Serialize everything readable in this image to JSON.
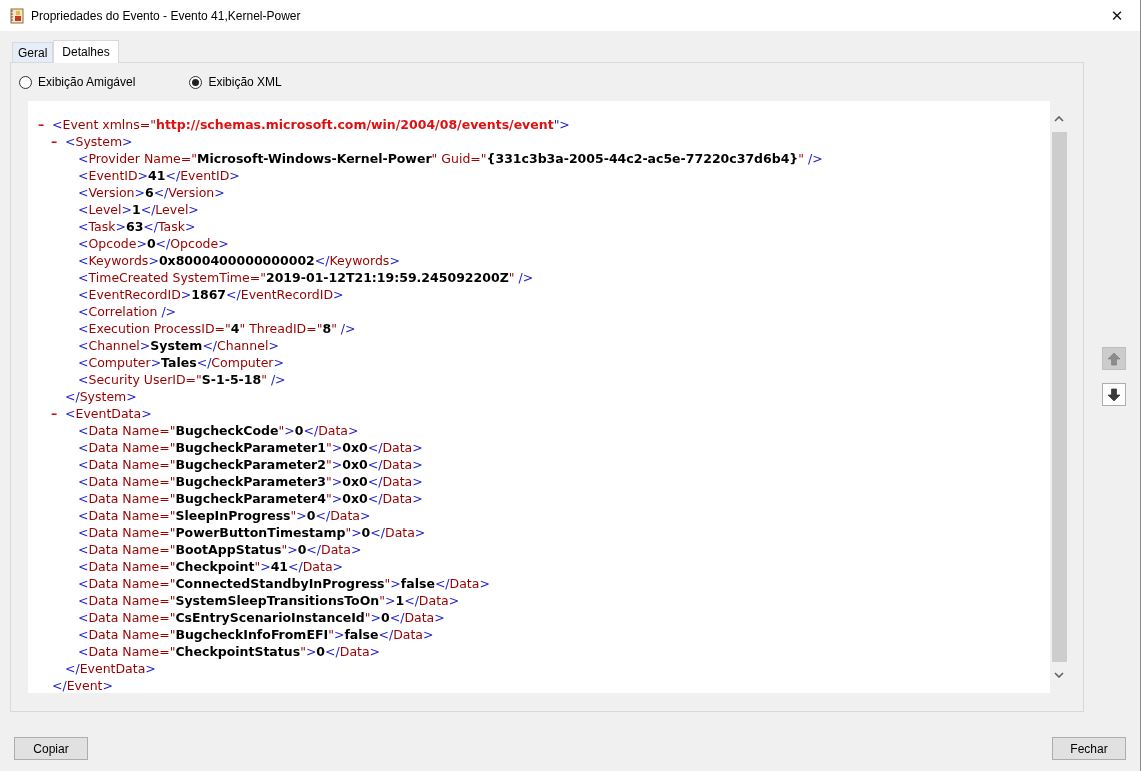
{
  "window": {
    "title": "Propriedades do Evento - Evento 41,Kernel-Power",
    "close": "✕"
  },
  "tabs": [
    {
      "label": "Geral",
      "selected": false
    },
    {
      "label": "Detalhes",
      "selected": true
    }
  ],
  "view_options": [
    {
      "label": "Exibição Amigável",
      "selected": false
    },
    {
      "label": "Exibição XML",
      "selected": true
    }
  ],
  "xml": {
    "toggle": "–",
    "expanded": true,
    "open": [
      {
        "kind": "markup",
        "text": "<"
      },
      {
        "kind": "tag",
        "text": "Event"
      },
      {
        "kind": "attr",
        "text": " xmlns=\""
      },
      {
        "kind": "ns",
        "text": "http://schemas.microsoft.com/win/2004/08/events/event"
      },
      {
        "kind": "markup",
        "text": "\">"
      }
    ],
    "close": [
      {
        "kind": "markup",
        "text": "</"
      },
      {
        "kind": "tag",
        "text": "Event"
      },
      {
        "kind": "markup",
        "text": ">"
      }
    ],
    "children": [
      {
        "toggle": "–",
        "expanded": true,
        "open": [
          {
            "kind": "markup",
            "text": "<"
          },
          {
            "kind": "tag",
            "text": "System"
          },
          {
            "kind": "markup",
            "text": ">"
          }
        ],
        "close": [
          {
            "kind": "markup",
            "text": "</"
          },
          {
            "kind": "tag",
            "text": "System"
          },
          {
            "kind": "markup",
            "text": ">"
          }
        ],
        "children": [
          {
            "open": [
              {
                "kind": "markup",
                "text": "<"
              },
              {
                "kind": "tag",
                "text": "Provider"
              },
              {
                "kind": "attr",
                "text": " Name=\""
              },
              {
                "kind": "value",
                "text": "Microsoft-Windows-Kernel-Power"
              },
              {
                "kind": "attr",
                "text": "\" Guid=\""
              },
              {
                "kind": "value",
                "text": "{331c3b3a-2005-44c2-ac5e-77220c37d6b4}"
              },
              {
                "kind": "attr",
                "text": "\""
              },
              {
                "kind": "markup",
                "text": " />"
              }
            ]
          },
          {
            "open": [
              {
                "kind": "markup",
                "text": "<"
              },
              {
                "kind": "tag",
                "text": "EventID"
              },
              {
                "kind": "markup",
                "text": ">"
              },
              {
                "kind": "text",
                "text": "41"
              },
              {
                "kind": "markup",
                "text": "</"
              },
              {
                "kind": "tag",
                "text": "EventID"
              },
              {
                "kind": "markup",
                "text": ">"
              }
            ]
          },
          {
            "open": [
              {
                "kind": "markup",
                "text": "<"
              },
              {
                "kind": "tag",
                "text": "Version"
              },
              {
                "kind": "markup",
                "text": ">"
              },
              {
                "kind": "text",
                "text": "6"
              },
              {
                "kind": "markup",
                "text": "</"
              },
              {
                "kind": "tag",
                "text": "Version"
              },
              {
                "kind": "markup",
                "text": ">"
              }
            ]
          },
          {
            "open": [
              {
                "kind": "markup",
                "text": "<"
              },
              {
                "kind": "tag",
                "text": "Level"
              },
              {
                "kind": "markup",
                "text": ">"
              },
              {
                "kind": "text",
                "text": "1"
              },
              {
                "kind": "markup",
                "text": "</"
              },
              {
                "kind": "tag",
                "text": "Level"
              },
              {
                "kind": "markup",
                "text": ">"
              }
            ]
          },
          {
            "open": [
              {
                "kind": "markup",
                "text": "<"
              },
              {
                "kind": "tag",
                "text": "Task"
              },
              {
                "kind": "markup",
                "text": ">"
              },
              {
                "kind": "text",
                "text": "63"
              },
              {
                "kind": "markup",
                "text": "</"
              },
              {
                "kind": "tag",
                "text": "Task"
              },
              {
                "kind": "markup",
                "text": ">"
              }
            ]
          },
          {
            "open": [
              {
                "kind": "markup",
                "text": "<"
              },
              {
                "kind": "tag",
                "text": "Opcode"
              },
              {
                "kind": "markup",
                "text": ">"
              },
              {
                "kind": "text",
                "text": "0"
              },
              {
                "kind": "markup",
                "text": "</"
              },
              {
                "kind": "tag",
                "text": "Opcode"
              },
              {
                "kind": "markup",
                "text": ">"
              }
            ]
          },
          {
            "open": [
              {
                "kind": "markup",
                "text": "<"
              },
              {
                "kind": "tag",
                "text": "Keywords"
              },
              {
                "kind": "markup",
                "text": ">"
              },
              {
                "kind": "text",
                "text": "0x8000400000000002"
              },
              {
                "kind": "markup",
                "text": "</"
              },
              {
                "kind": "tag",
                "text": "Keywords"
              },
              {
                "kind": "markup",
                "text": ">"
              }
            ]
          },
          {
            "open": [
              {
                "kind": "markup",
                "text": "<"
              },
              {
                "kind": "tag",
                "text": "TimeCreated"
              },
              {
                "kind": "attr",
                "text": " SystemTime=\""
              },
              {
                "kind": "value",
                "text": "2019-01-12T21:19:59.245092200Z"
              },
              {
                "kind": "attr",
                "text": "\""
              },
              {
                "kind": "markup",
                "text": " />"
              }
            ]
          },
          {
            "open": [
              {
                "kind": "markup",
                "text": "<"
              },
              {
                "kind": "tag",
                "text": "EventRecordID"
              },
              {
                "kind": "markup",
                "text": ">"
              },
              {
                "kind": "text",
                "text": "1867"
              },
              {
                "kind": "markup",
                "text": "</"
              },
              {
                "kind": "tag",
                "text": "EventRecordID"
              },
              {
                "kind": "markup",
                "text": ">"
              }
            ]
          },
          {
            "open": [
              {
                "kind": "markup",
                "text": "<"
              },
              {
                "kind": "tag",
                "text": "Correlation"
              },
              {
                "kind": "markup",
                "text": " />"
              }
            ]
          },
          {
            "open": [
              {
                "kind": "markup",
                "text": "<"
              },
              {
                "kind": "tag",
                "text": "Execution"
              },
              {
                "kind": "attr",
                "text": " ProcessID=\""
              },
              {
                "kind": "value",
                "text": "4"
              },
              {
                "kind": "attr",
                "text": "\" ThreadID=\""
              },
              {
                "kind": "value",
                "text": "8"
              },
              {
                "kind": "attr",
                "text": "\""
              },
              {
                "kind": "markup",
                "text": " />"
              }
            ]
          },
          {
            "open": [
              {
                "kind": "markup",
                "text": "<"
              },
              {
                "kind": "tag",
                "text": "Channel"
              },
              {
                "kind": "markup",
                "text": ">"
              },
              {
                "kind": "text",
                "text": "System"
              },
              {
                "kind": "markup",
                "text": "</"
              },
              {
                "kind": "tag",
                "text": "Channel"
              },
              {
                "kind": "markup",
                "text": ">"
              }
            ]
          },
          {
            "open": [
              {
                "kind": "markup",
                "text": "<"
              },
              {
                "kind": "tag",
                "text": "Computer"
              },
              {
                "kind": "markup",
                "text": ">"
              },
              {
                "kind": "text",
                "text": "Tales"
              },
              {
                "kind": "markup",
                "text": "</"
              },
              {
                "kind": "tag",
                "text": "Computer"
              },
              {
                "kind": "markup",
                "text": ">"
              }
            ]
          },
          {
            "open": [
              {
                "kind": "markup",
                "text": "<"
              },
              {
                "kind": "tag",
                "text": "Security"
              },
              {
                "kind": "attr",
                "text": " UserID=\""
              },
              {
                "kind": "value",
                "text": "S-1-5-18"
              },
              {
                "kind": "attr",
                "text": "\""
              },
              {
                "kind": "markup",
                "text": " />"
              }
            ]
          }
        ]
      },
      {
        "toggle": "–",
        "expanded": true,
        "open": [
          {
            "kind": "markup",
            "text": "<"
          },
          {
            "kind": "tag",
            "text": "EventData"
          },
          {
            "kind": "markup",
            "text": ">"
          }
        ],
        "close": [
          {
            "kind": "markup",
            "text": "</"
          },
          {
            "kind": "tag",
            "text": "EventData"
          },
          {
            "kind": "markup",
            "text": ">"
          }
        ],
        "children": [
          {
            "open": [
              {
                "kind": "markup",
                "text": "<"
              },
              {
                "kind": "tag",
                "text": "Data"
              },
              {
                "kind": "attr",
                "text": " Name=\""
              },
              {
                "kind": "value",
                "text": "BugcheckCode"
              },
              {
                "kind": "attr",
                "text": "\""
              },
              {
                "kind": "markup",
                "text": ">"
              },
              {
                "kind": "text",
                "text": "0"
              },
              {
                "kind": "markup",
                "text": "</"
              },
              {
                "kind": "tag",
                "text": "Data"
              },
              {
                "kind": "markup",
                "text": ">"
              }
            ]
          },
          {
            "open": [
              {
                "kind": "markup",
                "text": "<"
              },
              {
                "kind": "tag",
                "text": "Data"
              },
              {
                "kind": "attr",
                "text": " Name=\""
              },
              {
                "kind": "value",
                "text": "BugcheckParameter1"
              },
              {
                "kind": "attr",
                "text": "\""
              },
              {
                "kind": "markup",
                "text": ">"
              },
              {
                "kind": "text",
                "text": "0x0"
              },
              {
                "kind": "markup",
                "text": "</"
              },
              {
                "kind": "tag",
                "text": "Data"
              },
              {
                "kind": "markup",
                "text": ">"
              }
            ]
          },
          {
            "open": [
              {
                "kind": "markup",
                "text": "<"
              },
              {
                "kind": "tag",
                "text": "Data"
              },
              {
                "kind": "attr",
                "text": " Name=\""
              },
              {
                "kind": "value",
                "text": "BugcheckParameter2"
              },
              {
                "kind": "attr",
                "text": "\""
              },
              {
                "kind": "markup",
                "text": ">"
              },
              {
                "kind": "text",
                "text": "0x0"
              },
              {
                "kind": "markup",
                "text": "</"
              },
              {
                "kind": "tag",
                "text": "Data"
              },
              {
                "kind": "markup",
                "text": ">"
              }
            ]
          },
          {
            "open": [
              {
                "kind": "markup",
                "text": "<"
              },
              {
                "kind": "tag",
                "text": "Data"
              },
              {
                "kind": "attr",
                "text": " Name=\""
              },
              {
                "kind": "value",
                "text": "BugcheckParameter3"
              },
              {
                "kind": "attr",
                "text": "\""
              },
              {
                "kind": "markup",
                "text": ">"
              },
              {
                "kind": "text",
                "text": "0x0"
              },
              {
                "kind": "markup",
                "text": "</"
              },
              {
                "kind": "tag",
                "text": "Data"
              },
              {
                "kind": "markup",
                "text": ">"
              }
            ]
          },
          {
            "open": [
              {
                "kind": "markup",
                "text": "<"
              },
              {
                "kind": "tag",
                "text": "Data"
              },
              {
                "kind": "attr",
                "text": " Name=\""
              },
              {
                "kind": "value",
                "text": "BugcheckParameter4"
              },
              {
                "kind": "attr",
                "text": "\""
              },
              {
                "kind": "markup",
                "text": ">"
              },
              {
                "kind": "text",
                "text": "0x0"
              },
              {
                "kind": "markup",
                "text": "</"
              },
              {
                "kind": "tag",
                "text": "Data"
              },
              {
                "kind": "markup",
                "text": ">"
              }
            ]
          },
          {
            "open": [
              {
                "kind": "markup",
                "text": "<"
              },
              {
                "kind": "tag",
                "text": "Data"
              },
              {
                "kind": "attr",
                "text": " Name=\""
              },
              {
                "kind": "value",
                "text": "SleepInProgress"
              },
              {
                "kind": "attr",
                "text": "\""
              },
              {
                "kind": "markup",
                "text": ">"
              },
              {
                "kind": "text",
                "text": "0"
              },
              {
                "kind": "markup",
                "text": "</"
              },
              {
                "kind": "tag",
                "text": "Data"
              },
              {
                "kind": "markup",
                "text": ">"
              }
            ]
          },
          {
            "open": [
              {
                "kind": "markup",
                "text": "<"
              },
              {
                "kind": "tag",
                "text": "Data"
              },
              {
                "kind": "attr",
                "text": " Name=\""
              },
              {
                "kind": "value",
                "text": "PowerButtonTimestamp"
              },
              {
                "kind": "attr",
                "text": "\""
              },
              {
                "kind": "markup",
                "text": ">"
              },
              {
                "kind": "text",
                "text": "0"
              },
              {
                "kind": "markup",
                "text": "</"
              },
              {
                "kind": "tag",
                "text": "Data"
              },
              {
                "kind": "markup",
                "text": ">"
              }
            ]
          },
          {
            "open": [
              {
                "kind": "markup",
                "text": "<"
              },
              {
                "kind": "tag",
                "text": "Data"
              },
              {
                "kind": "attr",
                "text": " Name=\""
              },
              {
                "kind": "value",
                "text": "BootAppStatus"
              },
              {
                "kind": "attr",
                "text": "\""
              },
              {
                "kind": "markup",
                "text": ">"
              },
              {
                "kind": "text",
                "text": "0"
              },
              {
                "kind": "markup",
                "text": "</"
              },
              {
                "kind": "tag",
                "text": "Data"
              },
              {
                "kind": "markup",
                "text": ">"
              }
            ]
          },
          {
            "open": [
              {
                "kind": "markup",
                "text": "<"
              },
              {
                "kind": "tag",
                "text": "Data"
              },
              {
                "kind": "attr",
                "text": " Name=\""
              },
              {
                "kind": "value",
                "text": "Checkpoint"
              },
              {
                "kind": "attr",
                "text": "\""
              },
              {
                "kind": "markup",
                "text": ">"
              },
              {
                "kind": "text",
                "text": "41"
              },
              {
                "kind": "markup",
                "text": "</"
              },
              {
                "kind": "tag",
                "text": "Data"
              },
              {
                "kind": "markup",
                "text": ">"
              }
            ]
          },
          {
            "open": [
              {
                "kind": "markup",
                "text": "<"
              },
              {
                "kind": "tag",
                "text": "Data"
              },
              {
                "kind": "attr",
                "text": " Name=\""
              },
              {
                "kind": "value",
                "text": "ConnectedStandbyInProgress"
              },
              {
                "kind": "attr",
                "text": "\""
              },
              {
                "kind": "markup",
                "text": ">"
              },
              {
                "kind": "text",
                "text": "false"
              },
              {
                "kind": "markup",
                "text": "</"
              },
              {
                "kind": "tag",
                "text": "Data"
              },
              {
                "kind": "markup",
                "text": ">"
              }
            ]
          },
          {
            "open": [
              {
                "kind": "markup",
                "text": "<"
              },
              {
                "kind": "tag",
                "text": "Data"
              },
              {
                "kind": "attr",
                "text": " Name=\""
              },
              {
                "kind": "value",
                "text": "SystemSleepTransitionsToOn"
              },
              {
                "kind": "attr",
                "text": "\""
              },
              {
                "kind": "markup",
                "text": ">"
              },
              {
                "kind": "text",
                "text": "1"
              },
              {
                "kind": "markup",
                "text": "</"
              },
              {
                "kind": "tag",
                "text": "Data"
              },
              {
                "kind": "markup",
                "text": ">"
              }
            ]
          },
          {
            "open": [
              {
                "kind": "markup",
                "text": "<"
              },
              {
                "kind": "tag",
                "text": "Data"
              },
              {
                "kind": "attr",
                "text": " Name=\""
              },
              {
                "kind": "value",
                "text": "CsEntryScenarioInstanceId"
              },
              {
                "kind": "attr",
                "text": "\""
              },
              {
                "kind": "markup",
                "text": ">"
              },
              {
                "kind": "text",
                "text": "0"
              },
              {
                "kind": "markup",
                "text": "</"
              },
              {
                "kind": "tag",
                "text": "Data"
              },
              {
                "kind": "markup",
                "text": ">"
              }
            ]
          },
          {
            "open": [
              {
                "kind": "markup",
                "text": "<"
              },
              {
                "kind": "tag",
                "text": "Data"
              },
              {
                "kind": "attr",
                "text": " Name=\""
              },
              {
                "kind": "value",
                "text": "BugcheckInfoFromEFI"
              },
              {
                "kind": "attr",
                "text": "\""
              },
              {
                "kind": "markup",
                "text": ">"
              },
              {
                "kind": "text",
                "text": "false"
              },
              {
                "kind": "markup",
                "text": "</"
              },
              {
                "kind": "tag",
                "text": "Data"
              },
              {
                "kind": "markup",
                "text": ">"
              }
            ]
          },
          {
            "open": [
              {
                "kind": "markup",
                "text": "<"
              },
              {
                "kind": "tag",
                "text": "Data"
              },
              {
                "kind": "attr",
                "text": " Name=\""
              },
              {
                "kind": "value",
                "text": "CheckpointStatus"
              },
              {
                "kind": "attr",
                "text": "\""
              },
              {
                "kind": "markup",
                "text": ">"
              },
              {
                "kind": "text",
                "text": "0"
              },
              {
                "kind": "markup",
                "text": "</"
              },
              {
                "kind": "tag",
                "text": "Data"
              },
              {
                "kind": "markup",
                "text": ">"
              }
            ]
          }
        ]
      }
    ]
  },
  "navigation": [
    {
      "kind": "up",
      "disabled": true
    },
    {
      "kind": "down",
      "disabled": false
    }
  ],
  "buttons": [
    {
      "label": "Copiar"
    },
    {
      "label": "Fechar"
    }
  ]
}
